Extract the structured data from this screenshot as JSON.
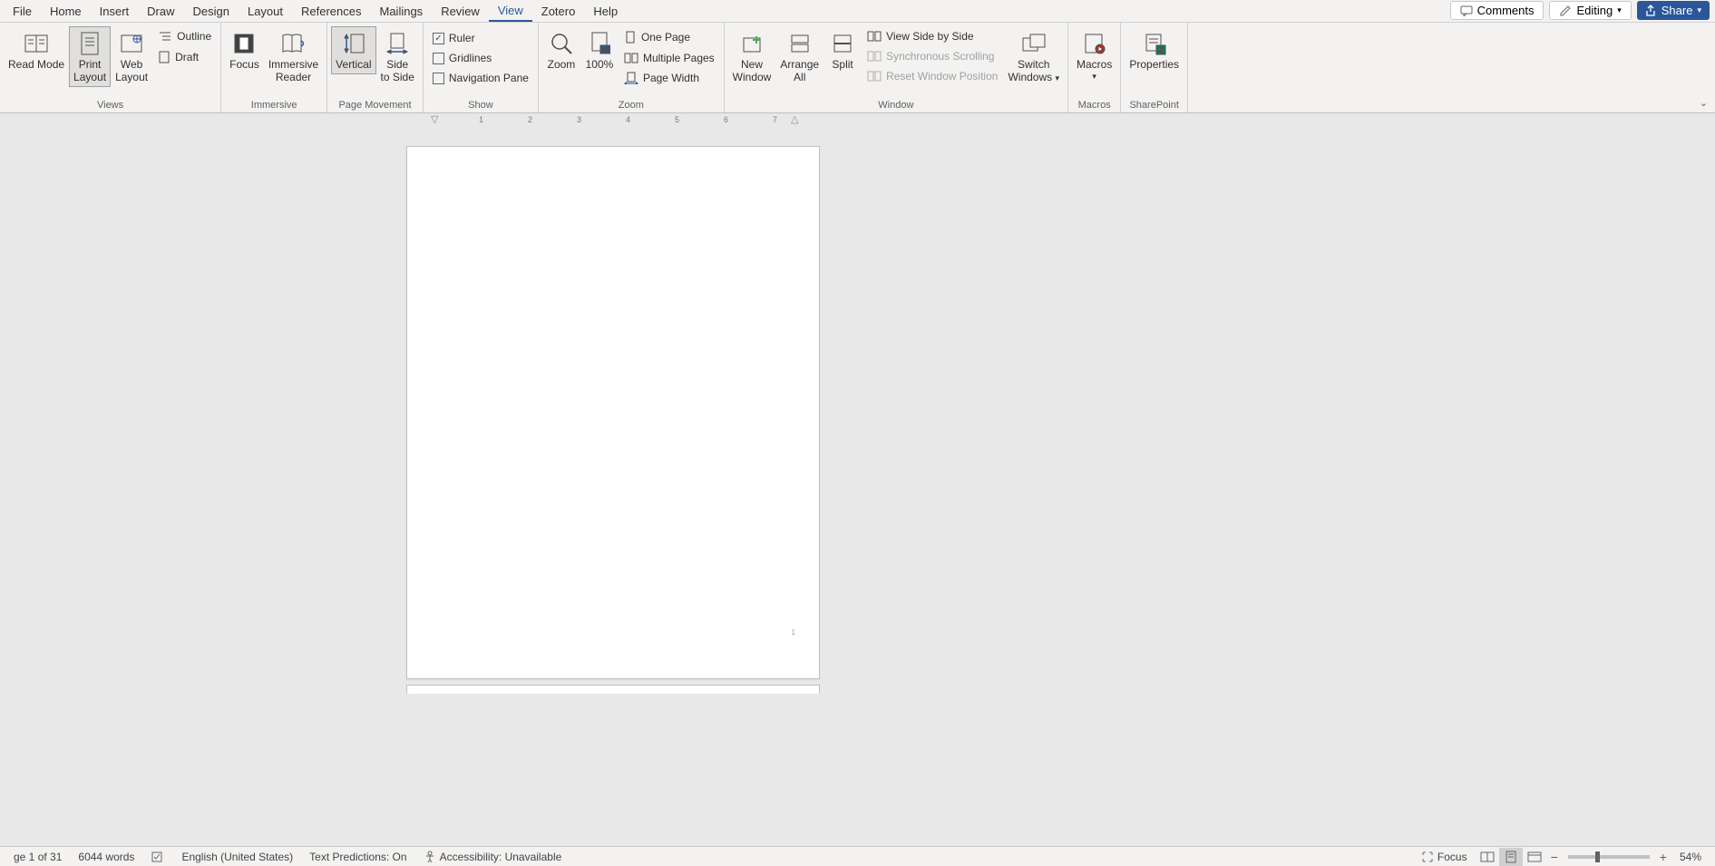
{
  "menubar": {
    "items": [
      "File",
      "Home",
      "Insert",
      "Draw",
      "Design",
      "Layout",
      "References",
      "Mailings",
      "Review",
      "View",
      "Zotero",
      "Help"
    ],
    "active_index": 9,
    "comments_label": "Comments",
    "editing_label": "Editing",
    "share_label": "Share"
  },
  "ribbon": {
    "views": {
      "label": "Views",
      "read_mode": "Read Mode",
      "print_layout": "Print Layout",
      "web_layout": "Web Layout",
      "outline": "Outline",
      "draft": "Draft"
    },
    "immersive": {
      "label": "Immersive",
      "focus": "Focus",
      "immersive_reader": "Immersive Reader"
    },
    "page_movement": {
      "label": "Page Movement",
      "vertical": "Vertical",
      "side_to_side": "Side to Side"
    },
    "show": {
      "label": "Show",
      "ruler": "Ruler",
      "ruler_checked": true,
      "gridlines": "Gridlines",
      "gridlines_checked": false,
      "nav_pane": "Navigation Pane",
      "nav_pane_checked": false
    },
    "zoom": {
      "label": "Zoom",
      "zoom": "Zoom",
      "hundred": "100%",
      "one_page": "One Page",
      "multiple_pages": "Multiple Pages",
      "page_width": "Page Width"
    },
    "window": {
      "label": "Window",
      "new_window": "New Window",
      "arrange_all": "Arrange All",
      "split": "Split",
      "side_by_side": "View Side by Side",
      "sync_scroll": "Synchronous Scrolling",
      "reset_pos": "Reset Window Position",
      "switch_windows": "Switch Windows"
    },
    "macros": {
      "label": "Macros",
      "macros": "Macros"
    },
    "sharepoint": {
      "label": "SharePoint",
      "properties": "Properties"
    }
  },
  "ruler": {
    "marks": [
      "1",
      "2",
      "3",
      "4",
      "5",
      "6",
      "7"
    ]
  },
  "document": {
    "page_number": "1"
  },
  "statusbar": {
    "page": "ge 1 of 31",
    "words": "6044 words",
    "language": "English (United States)",
    "predictions": "Text Predictions: On",
    "accessibility": "Accessibility: Unavailable",
    "focus": "Focus",
    "zoom_level": "54%"
  }
}
